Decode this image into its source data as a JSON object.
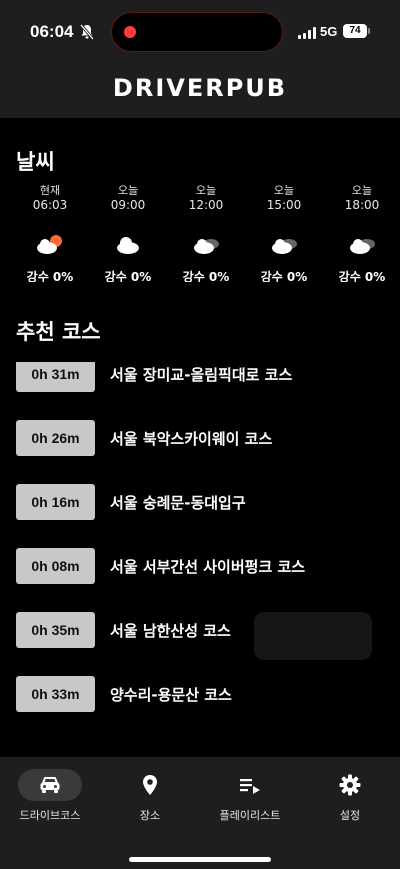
{
  "status_bar": {
    "time": "06:04",
    "network": "5G",
    "battery": "74",
    "icons": [
      "bell-off-icon",
      "signal-icon",
      "battery-icon"
    ]
  },
  "header": {
    "title": "DRIVERPUB"
  },
  "weather": {
    "title": "날씨",
    "items": [
      {
        "label": "현재",
        "time": "06:03",
        "icon": "sun-cloud-icon",
        "precip": "강수 0%"
      },
      {
        "label": "오늘",
        "time": "09:00",
        "icon": "cloud-icon",
        "precip": "강수 0%"
      },
      {
        "label": "오늘",
        "time": "12:00",
        "icon": "cloud-icon",
        "precip": "강수 0%"
      },
      {
        "label": "오늘",
        "time": "15:00",
        "icon": "cloud-icon",
        "precip": "강수 0%"
      },
      {
        "label": "오늘",
        "time": "18:00",
        "icon": "cloud-icon",
        "precip": "강수 0%"
      }
    ]
  },
  "courses": {
    "title": "추천 코스",
    "items": [
      {
        "duration": "0h 31m",
        "name": "서울 장미교-올림픽대로 코스"
      },
      {
        "duration": "0h 26m",
        "name": "서울 북악스카이웨이 코스"
      },
      {
        "duration": "0h 16m",
        "name": "서울 숭례문-동대입구"
      },
      {
        "duration": "0h 08m",
        "name": "서울 서부간선 사이버펑크 코스"
      },
      {
        "duration": "0h 35m",
        "name": "서울 남한산성 코스"
      },
      {
        "duration": "0h 33m",
        "name": "양수리-용문산 코스"
      }
    ]
  },
  "tabs": [
    {
      "label": "드라이브코스",
      "icon": "car-icon",
      "active": true
    },
    {
      "label": "장소",
      "icon": "location-pin-icon",
      "active": false
    },
    {
      "label": "플레이리스트",
      "icon": "playlist-icon",
      "active": false
    },
    {
      "label": "설정",
      "icon": "gear-icon",
      "active": false
    }
  ]
}
